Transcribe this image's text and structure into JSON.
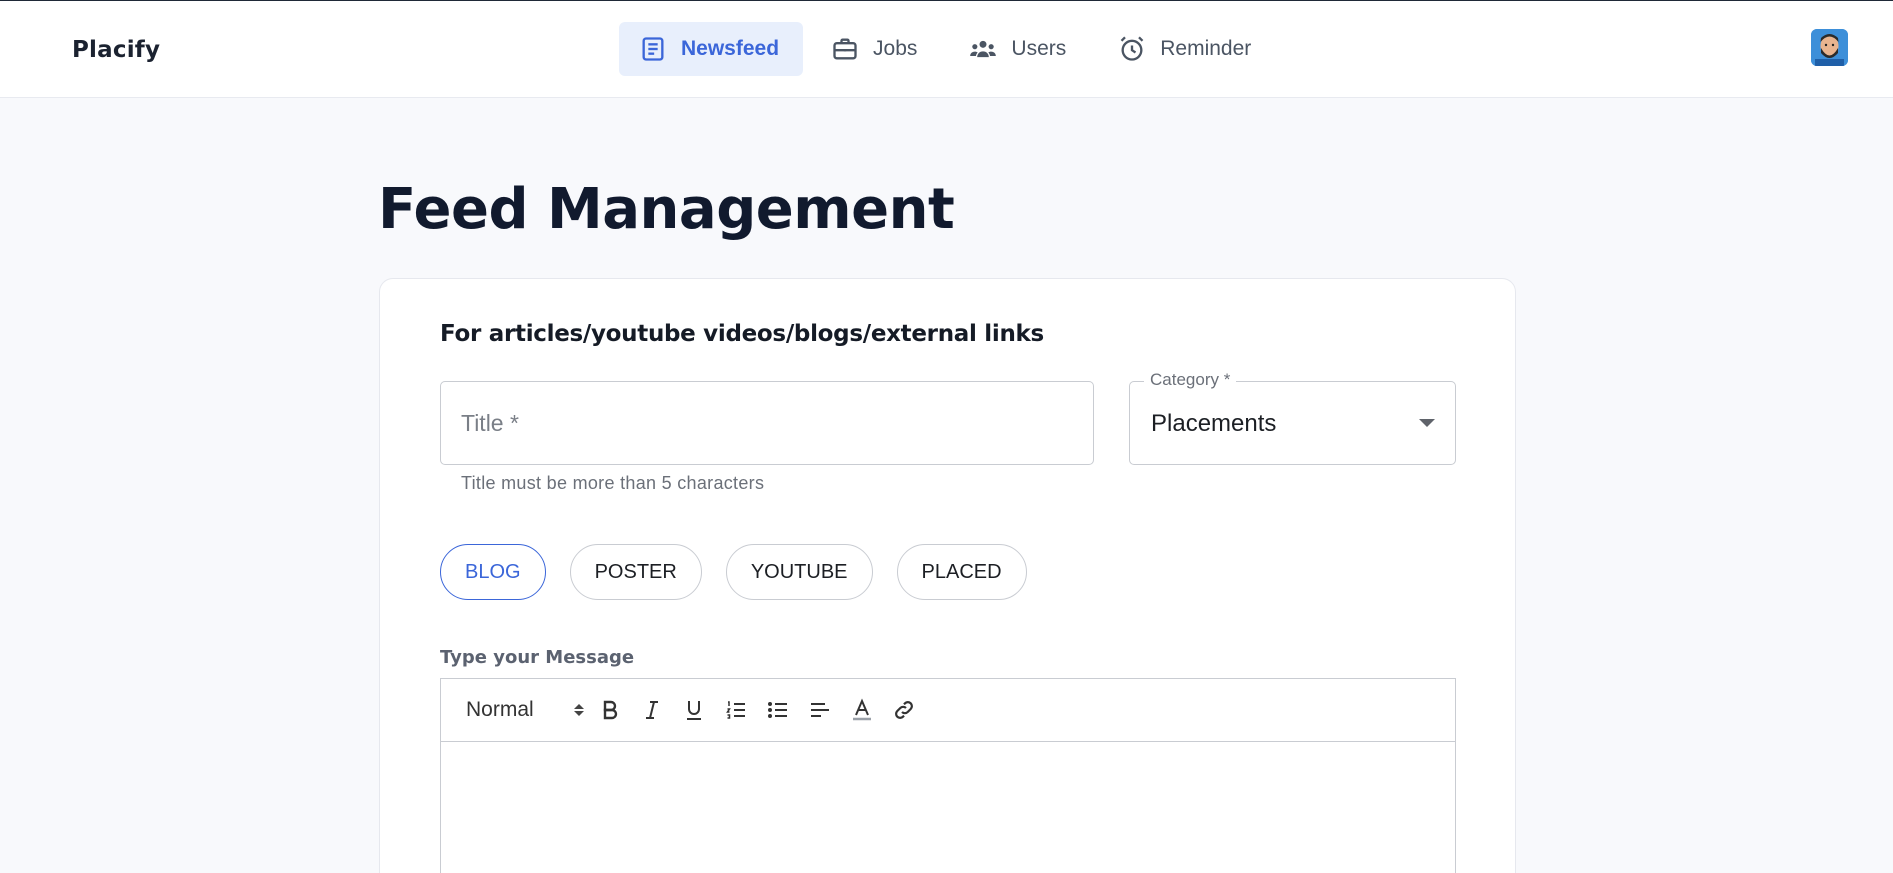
{
  "header": {
    "brand": "Placify",
    "nav": [
      {
        "label": "Newsfeed",
        "icon": "newsfeed-icon",
        "active": true
      },
      {
        "label": "Jobs",
        "icon": "briefcase-icon",
        "active": false
      },
      {
        "label": "Users",
        "icon": "users-icon",
        "active": false
      },
      {
        "label": "Reminder",
        "icon": "alarm-clock-icon",
        "active": false
      }
    ],
    "avatar_icon": "user-avatar"
  },
  "page": {
    "title": "Feed Management"
  },
  "form": {
    "heading": "For articles/youtube videos/blogs/external links",
    "title_placeholder": "Title *",
    "title_value": "",
    "title_helper": "Title must be more than 5 characters",
    "category_label": "Category *",
    "category_value": "Placements",
    "chips": [
      {
        "label": "BLOG",
        "selected": true
      },
      {
        "label": "POSTER",
        "selected": false
      },
      {
        "label": "YOUTUBE",
        "selected": false
      },
      {
        "label": "PLACED",
        "selected": false
      }
    ],
    "editor_label": "Type your Message",
    "editor": {
      "format_value": "Normal",
      "tools": [
        "bold-icon",
        "italic-icon",
        "underline-icon",
        "ordered-list-icon",
        "bullet-list-icon",
        "align-left-icon",
        "text-color-icon",
        "link-icon"
      ]
    }
  },
  "colors": {
    "accent": "#3b66d9",
    "accent_bg": "#e8effc",
    "page_bg": "#f8f9fc"
  }
}
